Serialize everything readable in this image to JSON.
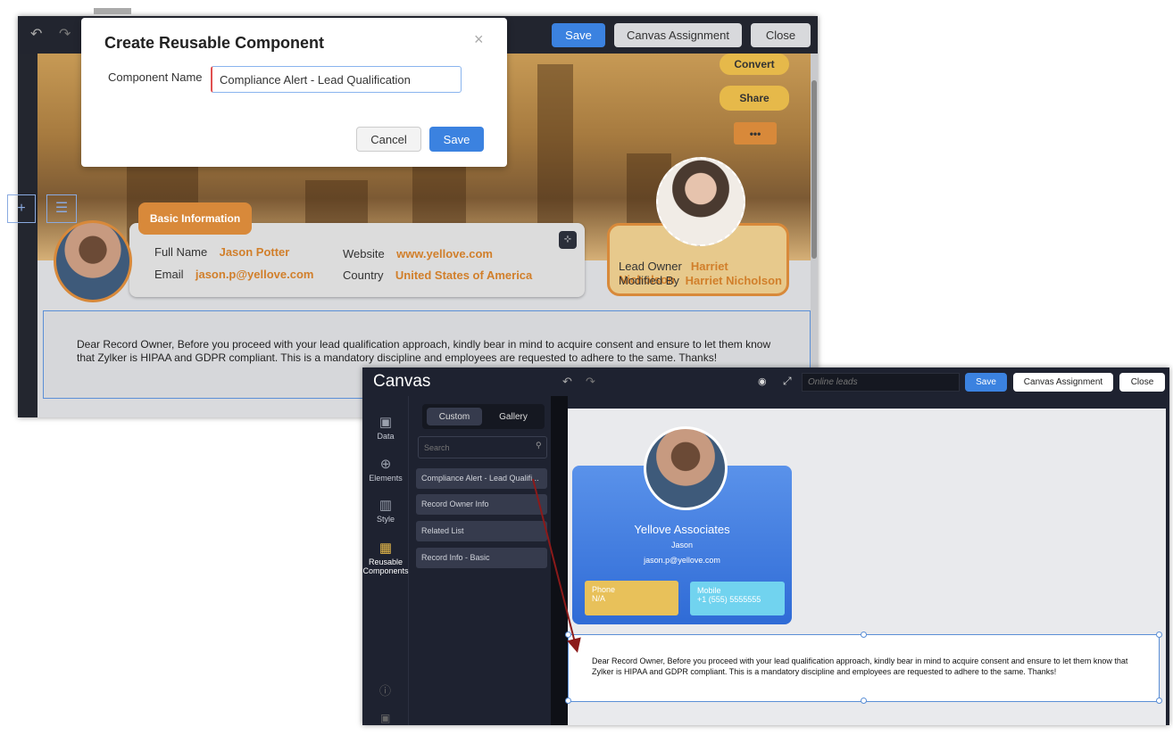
{
  "back_window": {
    "toolbar": {
      "save": "Save",
      "canvas_assignment": "Canvas Assignment",
      "close": "Close"
    },
    "actions": {
      "convert": "Convert",
      "share": "Share",
      "more": "•••"
    },
    "basic_info": {
      "tab": "Basic Information",
      "fields": [
        {
          "label": "Full Name",
          "value": "Jason Potter"
        },
        {
          "label": "Email",
          "value": "jason.p@yellove.com"
        },
        {
          "label": "Website",
          "value": "www.yellove.com"
        },
        {
          "label": "Country",
          "value": "United States of America"
        }
      ]
    },
    "owner": {
      "lead_owner_label": "Lead Owner",
      "lead_owner": "Harriet Nicholson",
      "modified_by_label": "Modified By",
      "modified_by": "Harriet Nicholson"
    },
    "message": "Dear Record Owner, Before you proceed with your lead qualification approach, kindly bear in mind to acquire consent and ensure to let them know that Zylker is HIPAA and GDPR compliant. This is a mandatory discipline and employees are requested to adhere to the same. Thanks!"
  },
  "modal": {
    "title": "Create Reusable Component",
    "field_label": "Component Name",
    "field_value": "Compliance Alert - Lead Qualification",
    "cancel": "Cancel",
    "save": "Save",
    "close": "×"
  },
  "front_window": {
    "logo": "Canvas",
    "layout_name_placeholder": "Online leads",
    "toolbar": {
      "save": "Save",
      "canvas_assignment": "Canvas Assignment",
      "close": "Close"
    },
    "sidebar": [
      {
        "label": "Data"
      },
      {
        "label": "Elements"
      },
      {
        "label": "Style"
      },
      {
        "label": "Reusable Components"
      }
    ],
    "tabs": {
      "custom": "Custom",
      "gallery": "Gallery"
    },
    "search_placeholder": "Search",
    "components": [
      "Compliance Alert - Lead Qualifi...",
      "Record Owner Info",
      "Related List",
      "Record Info - Basic"
    ],
    "card": {
      "company": "Yellove Associates",
      "name": "Jason",
      "email": "jason.p@yellove.com",
      "phone_label": "Phone",
      "phone": "N/A",
      "mobile_label": "Mobile",
      "mobile": "+1 (555) 5555555"
    },
    "message": "Dear Record Owner, Before you proceed with your lead qualification approach, kindly bear in mind to acquire consent and ensure to let them know that Zylker is HIPAA and GDPR compliant. This is a mandatory discipline and employees are requested to adhere to the same. Thanks!"
  }
}
